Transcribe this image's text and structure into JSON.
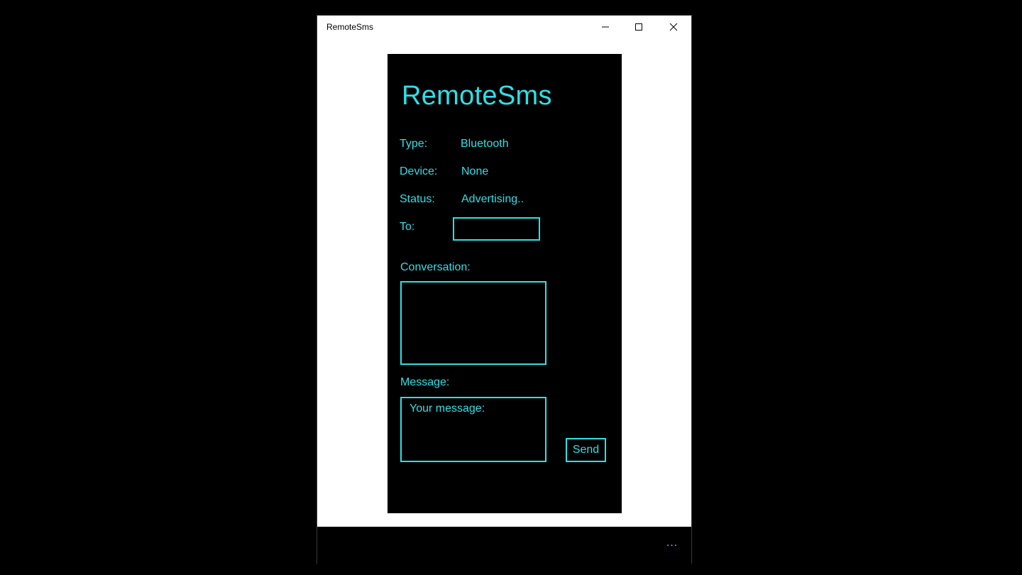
{
  "window": {
    "title": "RemoteSms"
  },
  "app": {
    "heading": "RemoteSms",
    "type_label": "Type:",
    "type_value": "Bluetooth",
    "device_label": "Device:",
    "device_value": "None",
    "status_label": "Status:",
    "status_value": "Advertising..",
    "to_label": "To:",
    "to_value": "",
    "conversation_label": "Conversation:",
    "conversation_value": "",
    "message_label": "Message:",
    "message_placeholder": "Your message:",
    "send_label": "Send"
  },
  "app_bar": {
    "more_label": "..."
  },
  "icons": {
    "minimize": "minimize-icon",
    "maximize": "maximize-icon",
    "close": "close-icon"
  },
  "colors": {
    "accent": "#2de0e8",
    "panel_background": "#000000",
    "window_background": "#ffffff"
  }
}
